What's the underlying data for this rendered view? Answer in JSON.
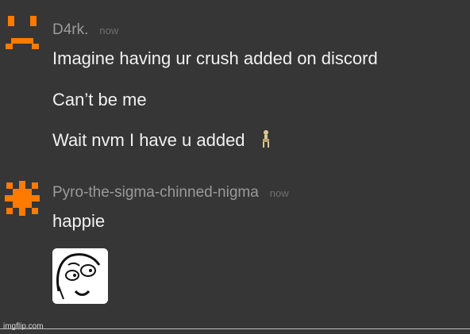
{
  "messages": [
    {
      "username": "D4rk.",
      "timestamp": "now",
      "lines": [
        "Imagine having ur crush added on discord",
        "Can’t be me",
        "Wait nvm I have u added"
      ]
    },
    {
      "username": "Pyro-the-sigma-chinned-nigma",
      "timestamp": "now",
      "lines": [
        "happie"
      ]
    }
  ],
  "watermark": "imgflip.com",
  "colors": {
    "background": "#363636",
    "avatar_orange": "#ff7a00",
    "username": "#9a9a9a",
    "timestamp": "#6f6f6f",
    "message_text": "#f1f1f1"
  },
  "icons": {
    "avatar_1": "sad-face-avatar-icon",
    "avatar_2": "orange-splat-avatar-icon",
    "emoji": "skeleton-emoji-icon",
    "sticker": "meme-face-sticker-icon"
  }
}
